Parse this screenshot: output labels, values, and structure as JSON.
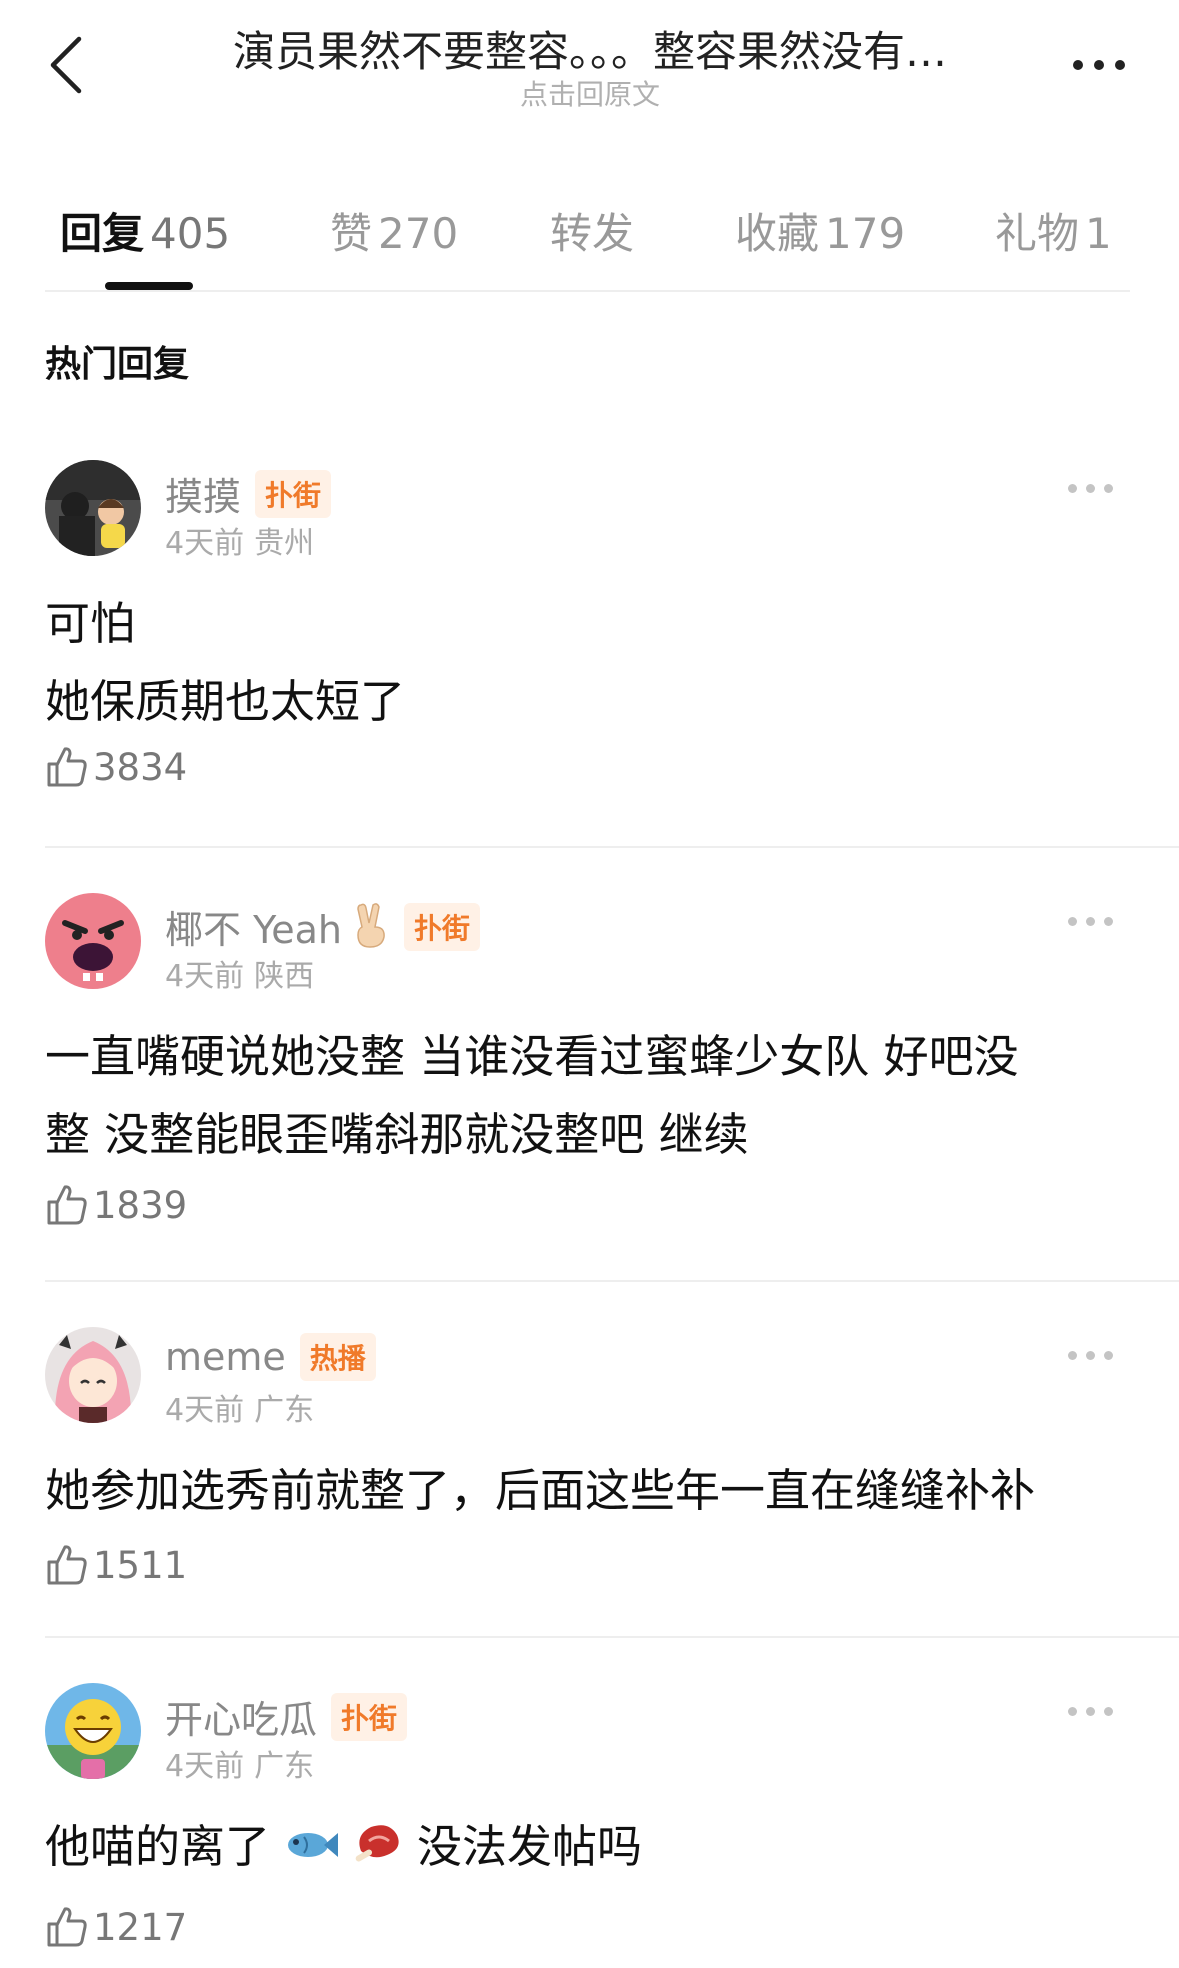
{
  "header": {
    "title": "演员果然不要整容。。。整容果然没有…",
    "subtitle": "点击回原文"
  },
  "tabs": [
    {
      "label": "回复",
      "count": "405"
    },
    {
      "label": "赞",
      "count": "270"
    },
    {
      "label": "转发",
      "count": ""
    },
    {
      "label": "收藏",
      "count": "179"
    },
    {
      "label": "礼物",
      "count": "1"
    }
  ],
  "section_title": "热门回复",
  "comments": [
    {
      "name": "摸摸",
      "badge": "扑街",
      "time": "4天前",
      "location": "贵州",
      "lines": [
        "可怕",
        "她保质期也太短了"
      ],
      "likes": "3834",
      "avatar_icon": "photo-avatar"
    },
    {
      "name": "椰不 Yeah",
      "badge": "扑街",
      "time": "4天前",
      "location": "陕西",
      "lines": [
        "一直嘴硬说她没整 当谁没看过蜜蜂少女队 好吧没",
        "整 没整能眼歪嘴斜那就没整吧 继续"
      ],
      "likes": "1839",
      "avatar_icon": "angry-pig-avatar"
    },
    {
      "name": "meme",
      "badge": "热播",
      "time": "4天前",
      "location": "广东",
      "lines": [
        "她参加选秀前就整了，后面这些年一直在缝缝补补"
      ],
      "likes": "1511",
      "avatar_icon": "anime-girl-avatar"
    },
    {
      "name": "开心吃瓜",
      "badge": "扑街",
      "time": "4天前",
      "location": "广东",
      "line_parts": [
        "他喵的离了",
        "没法发帖吗"
      ],
      "likes": "1217",
      "avatar_icon": "laughing-emoji-avatar"
    }
  ],
  "colors": {
    "badge": "#f07a2a",
    "badge_bg": "#fff1e6",
    "muted": "#999999",
    "text": "#111111"
  }
}
